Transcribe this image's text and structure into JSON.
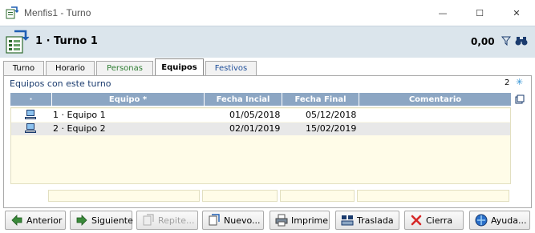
{
  "window": {
    "title": "Menfis1 - Turno",
    "minimize": "—",
    "maximize": "☐",
    "close": "✕"
  },
  "header": {
    "record_title": "1 · Turno 1",
    "value": "0,00",
    "icons": [
      "shift-record-icon",
      "filter-icon",
      "binoculars-icon"
    ]
  },
  "tabs": [
    {
      "label": "Turno",
      "active": false
    },
    {
      "label": "Horario",
      "active": false
    },
    {
      "label": "Personas",
      "active": false,
      "color": "#2e7d32"
    },
    {
      "label": "Equipos",
      "active": true
    },
    {
      "label": "Festivos",
      "active": false,
      "color": "#1f4f9a"
    }
  ],
  "panel": {
    "title": "Equipos con este turno",
    "count": "2",
    "columns": [
      "·",
      "Equipo *",
      "Fecha Incial",
      "Fecha Final",
      "Comentario"
    ],
    "rows": [
      {
        "icon": "computer-icon",
        "equipo": "1 · Equipo 1",
        "fecha_inicial": "01/05/2018",
        "fecha_final": "05/12/2018",
        "comentario": ""
      },
      {
        "icon": "computer-icon",
        "equipo": "2 · Equipo 2",
        "fecha_inicial": "02/01/2019",
        "fecha_final": "15/02/2019",
        "comentario": ""
      }
    ]
  },
  "buttons": [
    {
      "label": "Anterior",
      "icon": "arrow-left-icon",
      "enabled": true
    },
    {
      "label": "Siguiente",
      "icon": "arrow-right-icon",
      "enabled": true
    },
    {
      "label": "Repite...",
      "icon": "repeat-icon",
      "enabled": false
    },
    {
      "label": "Nuevo...",
      "icon": "new-icon",
      "enabled": true
    },
    {
      "label": "Imprime",
      "icon": "printer-icon",
      "enabled": true
    },
    {
      "label": "Traslada",
      "icon": "transfer-icon",
      "enabled": true
    },
    {
      "label": "Cierra",
      "icon": "close-x-icon",
      "enabled": true
    },
    {
      "label": "Ayuda...",
      "icon": "help-icon",
      "enabled": true
    }
  ],
  "colors": {
    "header_bg": "#dbe5ec",
    "grid_header": "#8ca6c3",
    "grid_body": "#fffce8",
    "close_red": "#d62828"
  }
}
